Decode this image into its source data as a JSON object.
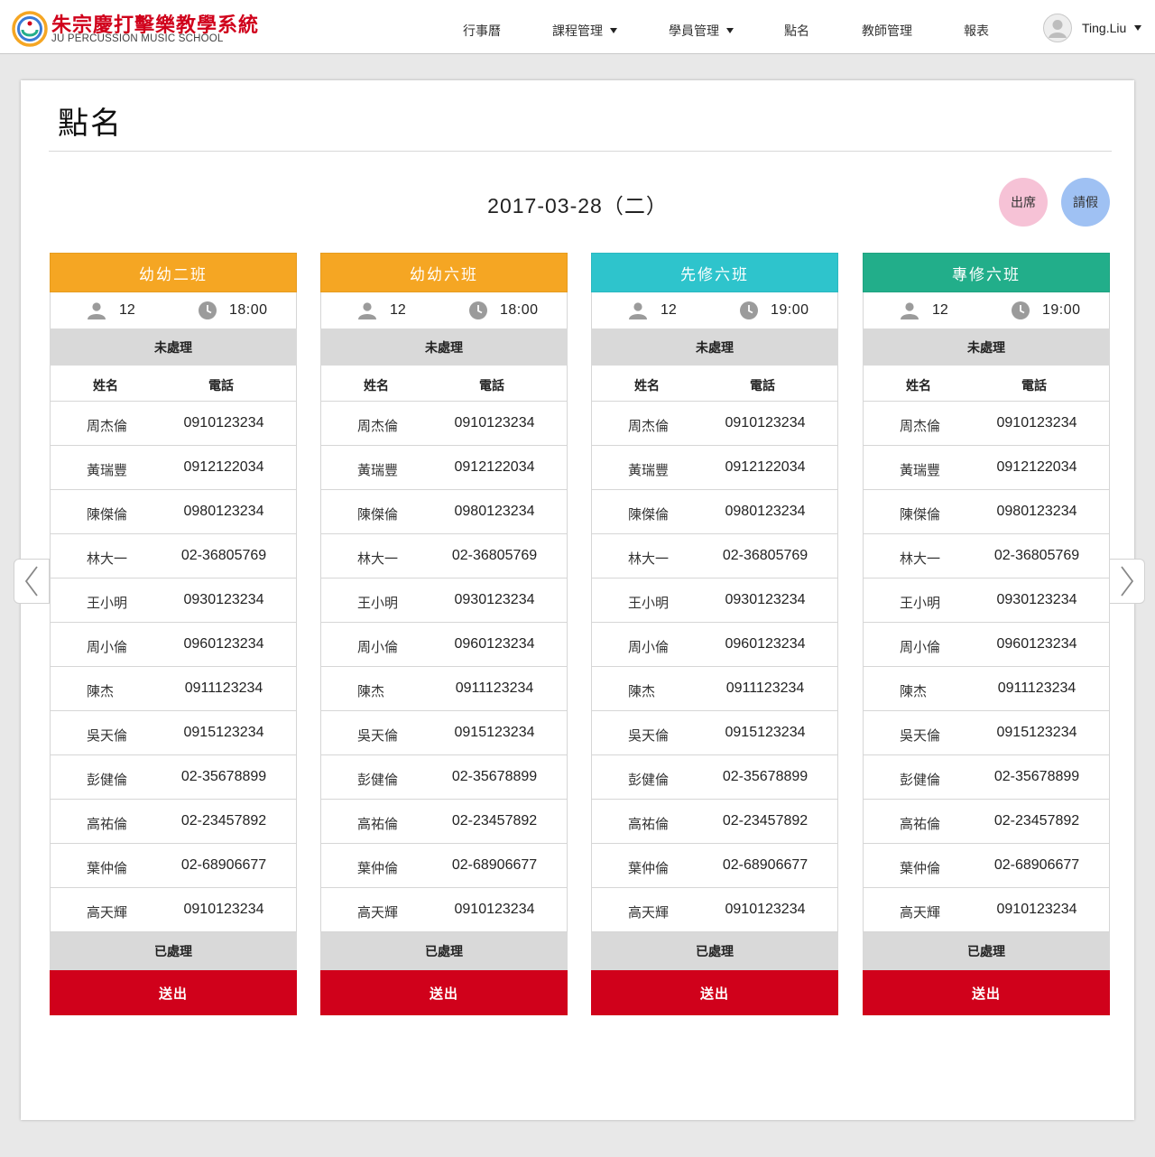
{
  "header": {
    "brand_cn": "朱宗慶打擊樂教學系統",
    "brand_en": "JU PERCUSSION MUSIC SCHOOL",
    "nav": [
      {
        "label": "行事曆",
        "dropdown": false
      },
      {
        "label": "課程管理",
        "dropdown": true
      },
      {
        "label": "學員管理",
        "dropdown": true
      },
      {
        "label": "點名",
        "dropdown": false
      },
      {
        "label": "教師管理",
        "dropdown": false
      },
      {
        "label": "報表",
        "dropdown": false
      }
    ],
    "user_name": "Ting.Liu"
  },
  "page": {
    "title": "點名",
    "date": "2017-03-28（二）",
    "legend": {
      "attend": "出席",
      "leave": "請假"
    }
  },
  "colors": {
    "brand_red": "#d0011b",
    "attend": "#f6c2d6",
    "leave": "#9fc1f3"
  },
  "icons": {
    "arrow_left": "chevron-left-icon",
    "arrow_right": "chevron-right-icon",
    "user": "user-icon",
    "clock": "clock-icon"
  },
  "classes": [
    {
      "name": "幼幼二班",
      "color": "#f5a623",
      "count": "12",
      "time": "18:00"
    },
    {
      "name": "幼幼六班",
      "color": "#f5a623",
      "count": "12",
      "time": "18:00"
    },
    {
      "name": "先修六班",
      "color": "#2ec4cc",
      "count": "12",
      "time": "19:00"
    },
    {
      "name": "專修六班",
      "color": "#22ae8a",
      "count": "12",
      "time": "19:00"
    }
  ],
  "labels": {
    "pending": "未處理",
    "processed": "已處理",
    "col_name": "姓名",
    "col_phone": "電話",
    "submit": "送出"
  },
  "students": [
    {
      "name": "周杰倫",
      "phone": "0910123234"
    },
    {
      "name": "黃瑞豐",
      "phone": "0912122034"
    },
    {
      "name": "陳傑倫",
      "phone": "0980123234"
    },
    {
      "name": "林大一",
      "phone": "02-36805769"
    },
    {
      "name": "王小明",
      "phone": "0930123234"
    },
    {
      "name": "周小倫",
      "phone": "0960123234"
    },
    {
      "name": "陳杰",
      "phone": "0911123234"
    },
    {
      "name": "吳天倫",
      "phone": "0915123234"
    },
    {
      "name": "彭健倫",
      "phone": "02-35678899"
    },
    {
      "name": "高祐倫",
      "phone": "02-23457892"
    },
    {
      "name": "葉仲倫",
      "phone": "02-68906677"
    },
    {
      "name": "高天輝",
      "phone": "0910123234"
    }
  ]
}
